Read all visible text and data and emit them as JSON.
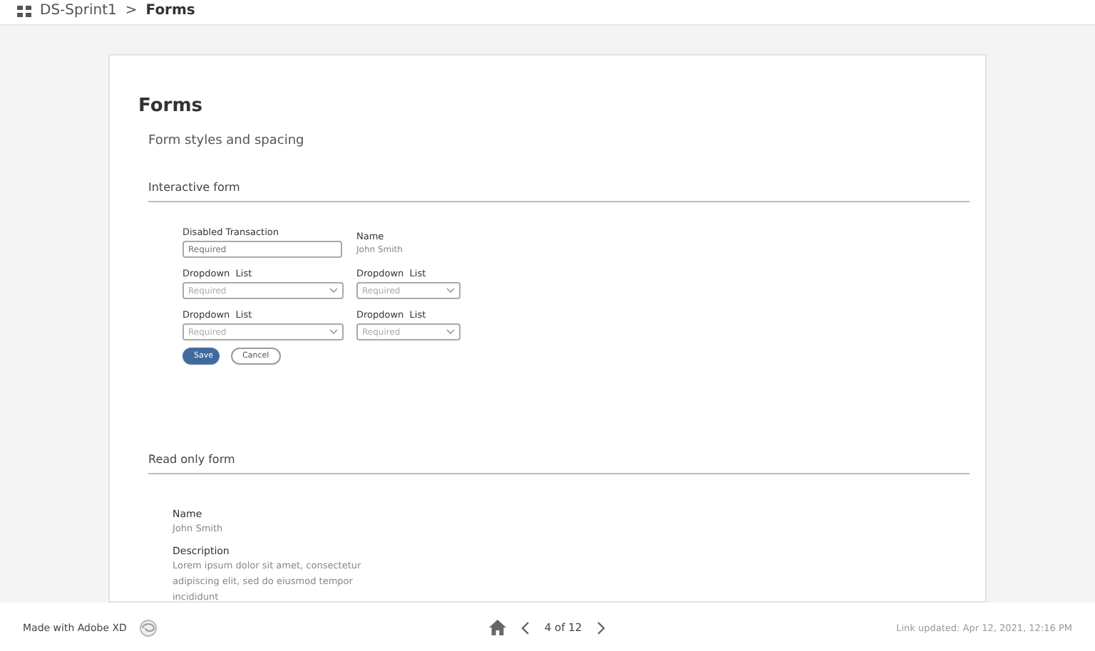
{
  "breadcrumb": {
    "project": "DS-Sprint1",
    "separator": ">",
    "page": "Forms"
  },
  "page": {
    "title": "Forms",
    "subtitle": "Form styles and spacing"
  },
  "interactive_form": {
    "heading": "Interactive form",
    "rows": [
      [
        {
          "kind": "input",
          "label": "Disabled Transaction",
          "placeholder": "Required"
        },
        {
          "kind": "readonly",
          "label": "Name",
          "value": "John Smith"
        }
      ],
      [
        {
          "kind": "dropdown",
          "label": "Dropdown  List",
          "placeholder": "Required"
        },
        {
          "kind": "dropdown",
          "label": "Dropdown  List",
          "placeholder": "Required"
        }
      ],
      [
        {
          "kind": "dropdown",
          "label": "Dropdown  List",
          "placeholder": "Required"
        },
        {
          "kind": "dropdown",
          "label": "Dropdown  List",
          "placeholder": "Required"
        }
      ]
    ],
    "buttons": [
      {
        "kind": "primary",
        "label": "Save"
      },
      {
        "kind": "secondary",
        "label": "Cancel"
      }
    ]
  },
  "read_only_form": {
    "heading": "Read only form",
    "fields": [
      {
        "label": "Name",
        "value": "John Smith"
      },
      {
        "label": "Description",
        "value": "Lorem ipsum dolor sit amet, consectetur adipiscing elit, sed do eiusmod tempor incididunt"
      }
    ]
  },
  "footer": {
    "made_with": "Made with Adobe XD",
    "pager": "4 of 12",
    "link_updated": "Link updated: Apr 12, 2021, 12:16 PM"
  }
}
